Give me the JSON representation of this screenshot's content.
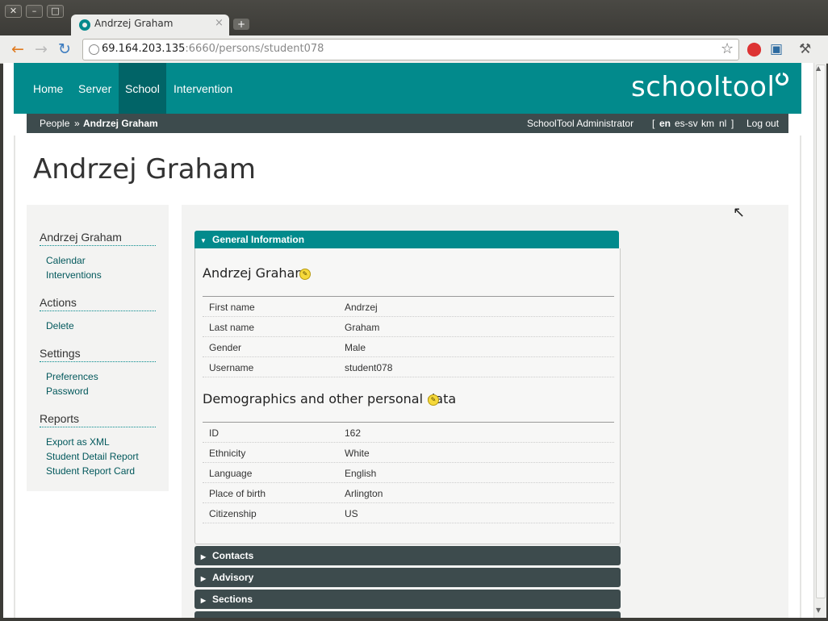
{
  "window": {
    "controls": [
      "✕",
      "–",
      "□"
    ]
  },
  "tab": {
    "title": "Andrzej Graham",
    "close": "×",
    "new_tab": "+"
  },
  "toolbar": {
    "url_host": "69.164.203.135",
    "url_rest": ":6660/persons/student078"
  },
  "nav": {
    "items": [
      "Home",
      "Server",
      "School",
      "Intervention"
    ],
    "active": "School",
    "logo": "schooltool"
  },
  "breadcrumb": {
    "parent": "People",
    "separator": "»",
    "current": "Andrzej Graham",
    "user": "SchoolTool Administrator",
    "lang_open": "[",
    "languages": [
      "en",
      "es-sv",
      "km",
      "nl"
    ],
    "lang_close": "]",
    "logout": "Log out"
  },
  "page": {
    "title": "Andrzej Graham"
  },
  "sidebar": {
    "person_heading": "Andrzej Graham",
    "person_links": [
      "Calendar",
      "Interventions"
    ],
    "actions_heading": "Actions",
    "actions_links": [
      "Delete"
    ],
    "settings_heading": "Settings",
    "settings_links": [
      "Preferences",
      "Password"
    ],
    "reports_heading": "Reports",
    "reports_links": [
      "Export as XML",
      "Student Detail Report",
      "Student Report Card"
    ]
  },
  "general_info": {
    "header": "General Information",
    "section1_title": "Andrzej Graham",
    "section1_rows": [
      {
        "label": "First name",
        "value": "Andrzej"
      },
      {
        "label": "Last name",
        "value": "Graham"
      },
      {
        "label": "Gender",
        "value": "Male"
      },
      {
        "label": "Username",
        "value": "student078"
      }
    ],
    "section2_title": "Demographics and other personal data",
    "section2_rows": [
      {
        "label": "ID",
        "value": "162"
      },
      {
        "label": "Ethnicity",
        "value": "White"
      },
      {
        "label": "Language",
        "value": "English"
      },
      {
        "label": "Place of birth",
        "value": "Arlington"
      },
      {
        "label": "Citizenship",
        "value": "US"
      }
    ]
  },
  "collapsed_panels": [
    "Contacts",
    "Advisory",
    "Sections"
  ],
  "colors": {
    "accent": "#028a8c",
    "accent_dark": "#016467",
    "bar_dark": "#3d4b4d"
  }
}
